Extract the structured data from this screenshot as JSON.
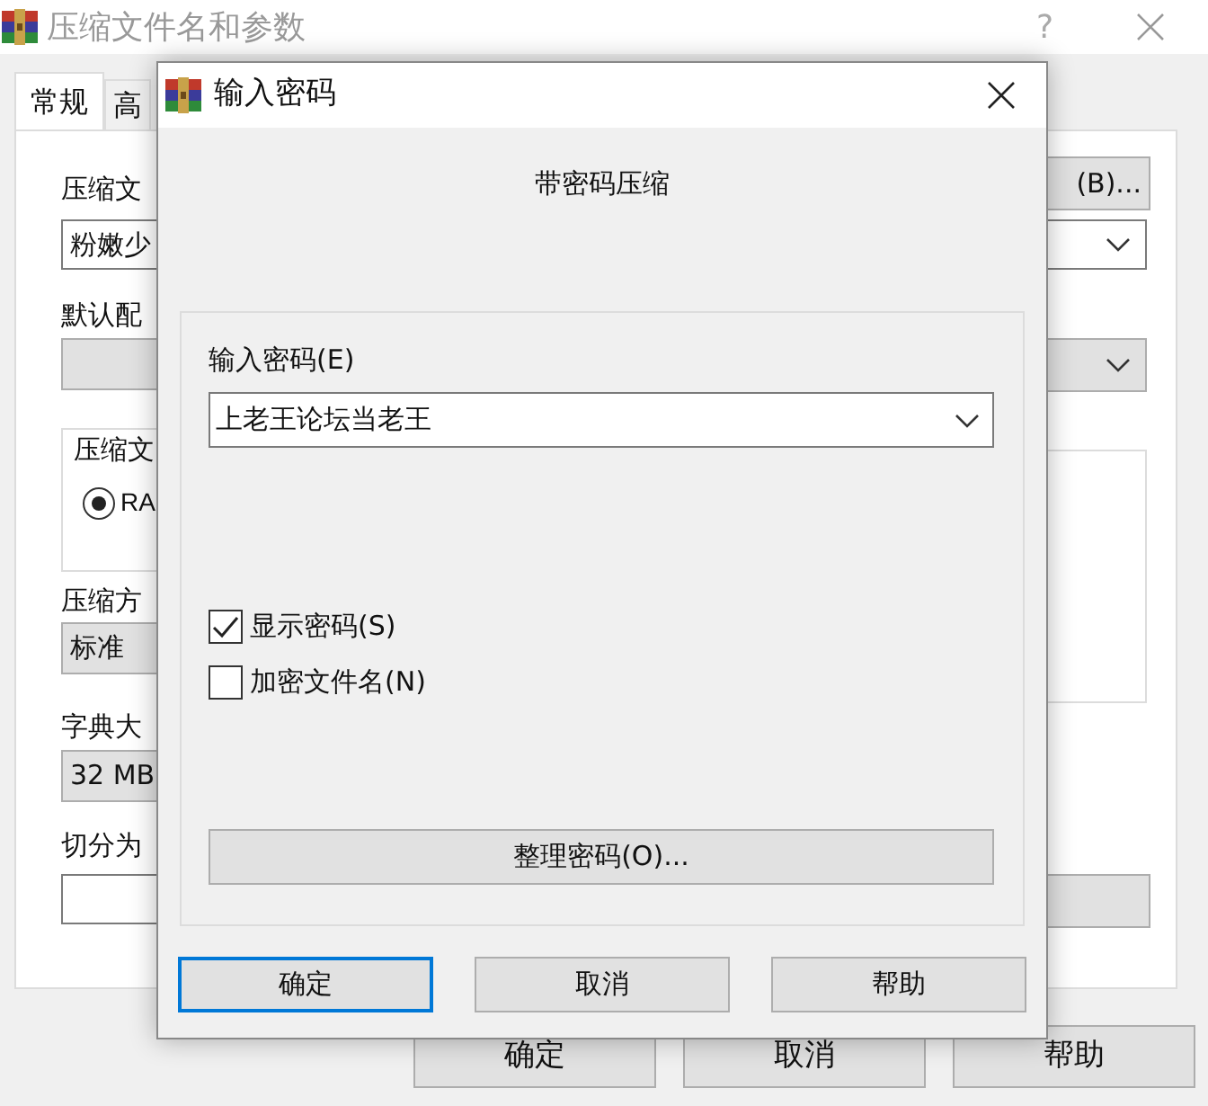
{
  "window": {
    "title": "压缩文件名和参数",
    "help": "?"
  },
  "tabs": [
    {
      "label": "常规",
      "selected": true
    },
    {
      "label": "高",
      "selected": false
    }
  ],
  "left_column": [
    {
      "kind": "label",
      "text": "压缩文"
    },
    {
      "kind": "field",
      "text": "粉嫩少"
    },
    {
      "kind": "label",
      "text": "默认配"
    },
    {
      "kind": "combo"
    },
    {
      "kind": "group",
      "text": "压缩文",
      "option": {
        "label": "RA",
        "selected": true
      }
    },
    {
      "kind": "label",
      "text": "压缩方"
    },
    {
      "kind": "combo",
      "text": "标准"
    },
    {
      "kind": "label",
      "text": "字典大"
    },
    {
      "kind": "combo",
      "text": "32 MB"
    },
    {
      "kind": "label",
      "text": "切分为"
    },
    {
      "kind": "field"
    }
  ],
  "right_column": [
    {
      "kind": "button",
      "text": "(B)..."
    },
    {
      "kind": "field-dropdown"
    },
    {
      "kind": "combo-dropdown"
    },
    {
      "kind": "group"
    },
    {
      "kind": "button"
    }
  ],
  "buttons": [
    "确定",
    "取消",
    "帮助"
  ],
  "dialog": {
    "title": "输入密码",
    "heading": "带密码压缩",
    "password_label": "输入密码(E)",
    "password": "上老王论坛当老王",
    "options": [
      {
        "label": "显示密码(S)",
        "checked": true
      },
      {
        "label": "加密文件名(N)",
        "checked": false
      }
    ],
    "organize_button": "整理密码(O)...",
    "buttons": [
      {
        "label": "确定",
        "default": true
      },
      {
        "label": "取消",
        "default": false
      },
      {
        "label": "帮助",
        "default": false
      }
    ]
  }
}
